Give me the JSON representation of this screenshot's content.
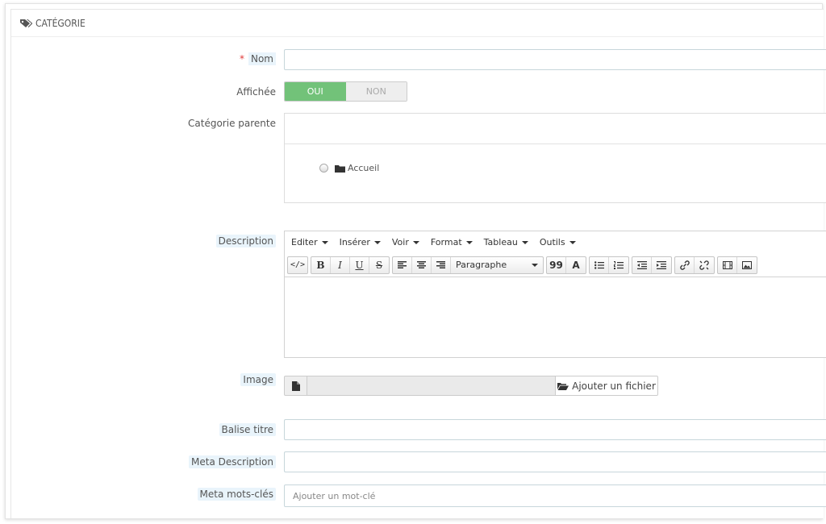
{
  "panel": {
    "title": "CATÉGORIE",
    "icon": "tags-icon"
  },
  "fields": {
    "name": {
      "label": "Nom",
      "required_mark": "*",
      "value": ""
    },
    "displayed": {
      "label": "Affichée",
      "on_label": "OUI",
      "off_label": "NON",
      "selected": "OUI"
    },
    "parent": {
      "label": "Catégorie parente",
      "tree_items": [
        {
          "label": "Accueil",
          "icon": "folder-icon",
          "selected": false
        }
      ]
    },
    "description": {
      "label": "Description",
      "menu": [
        "Editer",
        "Insérer",
        "Voir",
        "Format",
        "Tableau",
        "Outils"
      ],
      "format_select": "Paragraphe"
    },
    "image": {
      "label": "Image",
      "button_label": "Ajouter un fichier"
    },
    "meta_title": {
      "label": "Balise titre",
      "value": ""
    },
    "meta_description": {
      "label": "Meta Description",
      "value": ""
    },
    "meta_keywords": {
      "label": "Meta mots-clés",
      "placeholder": "Ajouter un mot-clé"
    }
  },
  "colors": {
    "switch_on": "#72c279",
    "required": "#e03b3b",
    "hint_bg": "#e9f4fb"
  }
}
